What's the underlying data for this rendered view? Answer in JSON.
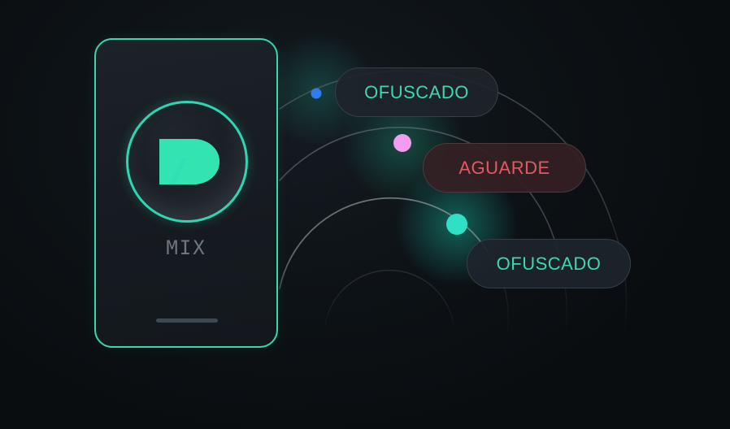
{
  "brand": {
    "name": "MIX",
    "logo_icon": "mix-logo-icon"
  },
  "colors": {
    "accent": "#3ad6ad",
    "warning": "#e15a63",
    "dot_blue": "#2f7bf0",
    "dot_pink": "#f29df0",
    "dot_teal": "#2fe0c6"
  },
  "statuses": [
    {
      "label": "OFUSCADO",
      "state": "ok"
    },
    {
      "label": "AGUARDE",
      "state": "waiting"
    },
    {
      "label": "OFUSCADO",
      "state": "ok"
    }
  ]
}
